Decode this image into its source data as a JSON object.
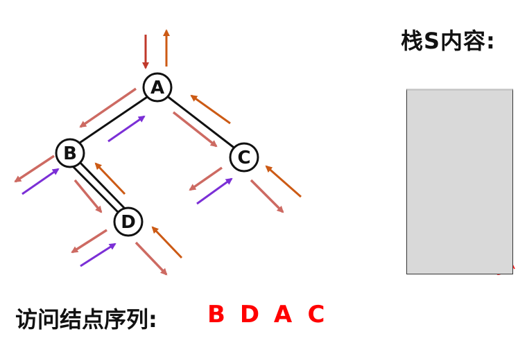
{
  "tree": {
    "nodes": [
      {
        "id": "A",
        "label": "A"
      },
      {
        "id": "B",
        "label": "B"
      },
      {
        "id": "C",
        "label": "C"
      },
      {
        "id": "D",
        "label": "D"
      }
    ],
    "edges": [
      {
        "from": "A",
        "to": "B"
      },
      {
        "from": "A",
        "to": "C"
      },
      {
        "from": "B",
        "to": "D"
      }
    ]
  },
  "stack": {
    "title": "栈S内容:"
  },
  "visit_sequence": {
    "label": "访问结点序列:",
    "items": [
      "B",
      "D",
      "A",
      "C"
    ]
  },
  "colors": {
    "arrow_dark_red": "#c0392b",
    "arrow_brown": "#cc5a14",
    "arrow_salmon": "#cd6a62",
    "arrow_purple": "#7b2fd6",
    "ink_red": "#ff1a1a",
    "sequence_red": "#ff0000"
  }
}
